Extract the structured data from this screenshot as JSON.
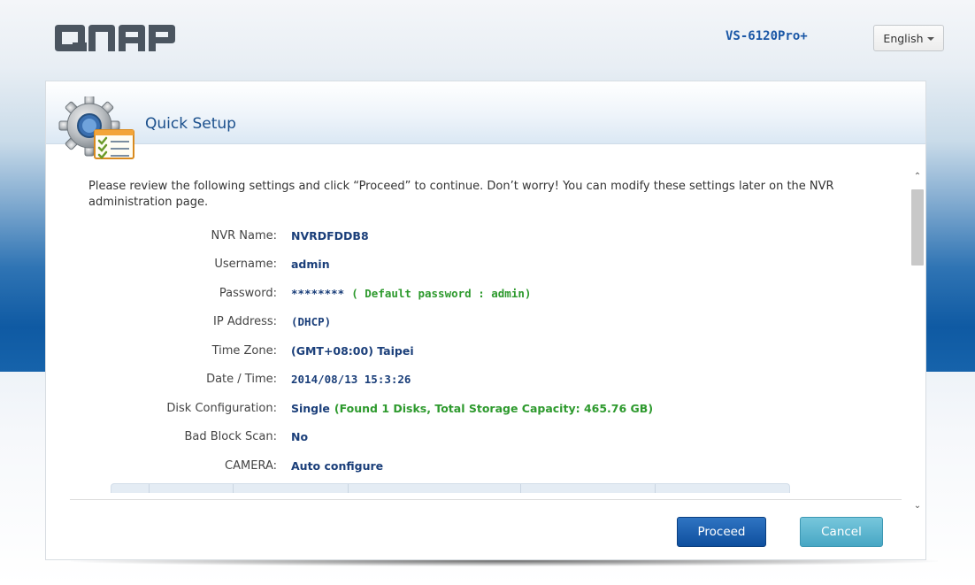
{
  "header": {
    "brand": "QNAP",
    "model": "VS-6120Pro+",
    "language": "English"
  },
  "dialog": {
    "title": "Quick Setup",
    "icon": "quick-setup-gear-checklist-icon",
    "intro": "Please review the following settings and click “Proceed” to continue. Don’t worry! You can modify these settings later on the NVR administration page.",
    "settings": [
      {
        "label": "NVR Name:",
        "value": "NVRDFDDB8",
        "note": ""
      },
      {
        "label": "Username:",
        "value": "admin",
        "note": ""
      },
      {
        "label": "Password:",
        "value": "********",
        "note": "( Default password : admin)"
      },
      {
        "label": "IP Address:",
        "value": "(DHCP)",
        "note": ""
      },
      {
        "label": "Time Zone:",
        "value": "(GMT+08:00) Taipei",
        "note": ""
      },
      {
        "label": "Date / Time:",
        "value": "2014/08/13 15:3:26",
        "note": ""
      },
      {
        "label": "Disk Configuration:",
        "value": "Single",
        "note": "(Found 1 Disks, Total Storage Capacity: 465.76 GB)"
      },
      {
        "label": "Bad Block Scan:",
        "value": "No",
        "note": ""
      },
      {
        "label": "CAMERA:",
        "value": "Auto configure",
        "note": ""
      }
    ],
    "buttons": {
      "proceed": "Proceed",
      "cancel": "Cancel"
    }
  },
  "colors": {
    "primary_button": "#0e4f9e",
    "secondary_button": "#47a7c4",
    "value_text": "#1b3f7a",
    "note_text": "#2e9a2e",
    "model_text": "#1a57a6"
  }
}
